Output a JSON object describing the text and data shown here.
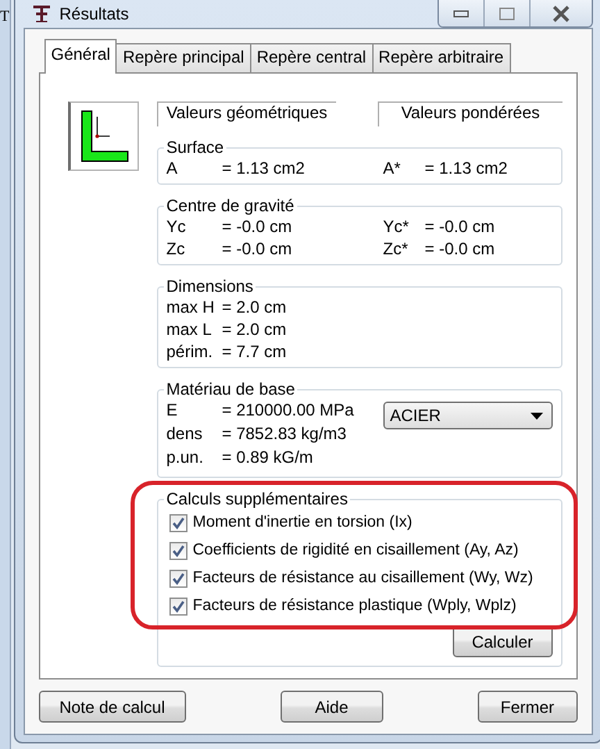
{
  "background_text": "T",
  "window": {
    "title": "Résultats"
  },
  "tabs": [
    {
      "label": "Général",
      "selected": true
    },
    {
      "label": "Repère principal",
      "selected": false
    },
    {
      "label": "Repère central",
      "selected": false
    },
    {
      "label": "Repère arbitraire",
      "selected": false
    }
  ],
  "column_headers": [
    "Valeurs géométriques",
    "Valeurs pondérées"
  ],
  "groups": [
    {
      "title": "Surface",
      "rows": [
        [
          "A",
          "= 1.13 cm2",
          "A*",
          "= 1.13 cm2"
        ]
      ]
    },
    {
      "title": "Centre de gravité",
      "rows": [
        [
          "Yc",
          "= -0.0 cm",
          "Yc*",
          "= -0.0 cm"
        ],
        [
          "Zc",
          "= -0.0 cm",
          "Zc*",
          "= -0.0 cm"
        ]
      ]
    },
    {
      "title": "Dimensions",
      "rows": [
        [
          "max H",
          "= 2.0 cm"
        ],
        [
          "max L",
          "= 2.0 cm"
        ],
        [
          "périm.",
          "= 7.7 cm"
        ]
      ]
    }
  ],
  "material": {
    "title": "Matériau de base",
    "rows": [
      [
        "E",
        "= 210000.00 MPa"
      ],
      [
        "dens",
        "= 7852.83 kg/m3"
      ],
      [
        "p.un.",
        "= 0.89 kG/m"
      ]
    ],
    "dropdown": "ACIER"
  },
  "extra": {
    "title": "Calculs supplémentaires",
    "highlighted": true,
    "options": [
      {
        "label": "Moment d'inertie en torsion (Ix)",
        "checked": true
      },
      {
        "label": "Coefficients de rigidité en cisaillement (Ay, Az)",
        "checked": true
      },
      {
        "label": "Facteurs de résistance au cisaillement (Wy, Wz)",
        "checked": true
      },
      {
        "label": "Facteurs de résistance plastique (Wply, Wplz)",
        "checked": true
      }
    ],
    "button": "Calculer"
  },
  "buttons": [
    "Note de calcul",
    "Aide",
    "Fermer"
  ]
}
